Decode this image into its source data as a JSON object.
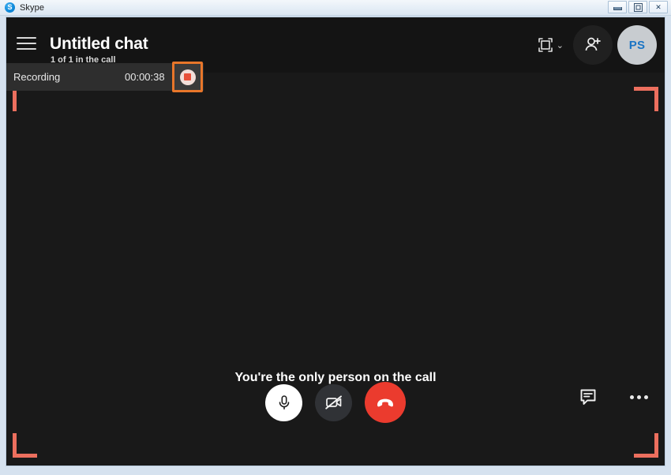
{
  "titlebar": {
    "app_name": "Skype",
    "logo_letter": "S",
    "minimize_label": "Minimize",
    "maximize_label": "Maximize",
    "close_label": "Close",
    "close_glyph": "✕"
  },
  "header": {
    "menu_label": "Menu",
    "chat_title": "Untitled chat",
    "subtitle": "1 of 1 in the call",
    "layout_label": "Change view",
    "layout_chevron": "⌄",
    "add_people_label": "Add people",
    "avatar_initials": "PS"
  },
  "recording": {
    "label": "Recording",
    "timer": "00:00:38",
    "stop_label": "Stop recording",
    "highlight_color": "#e8762a",
    "bracket_color": "#ec6f5e"
  },
  "stage": {
    "message": "You're the only person on the call"
  },
  "controls": {
    "mic_label": "Mute microphone",
    "camera_label": "Start video",
    "end_call_label": "End call",
    "chat_label": "Show conversation",
    "more_label": "More options"
  }
}
